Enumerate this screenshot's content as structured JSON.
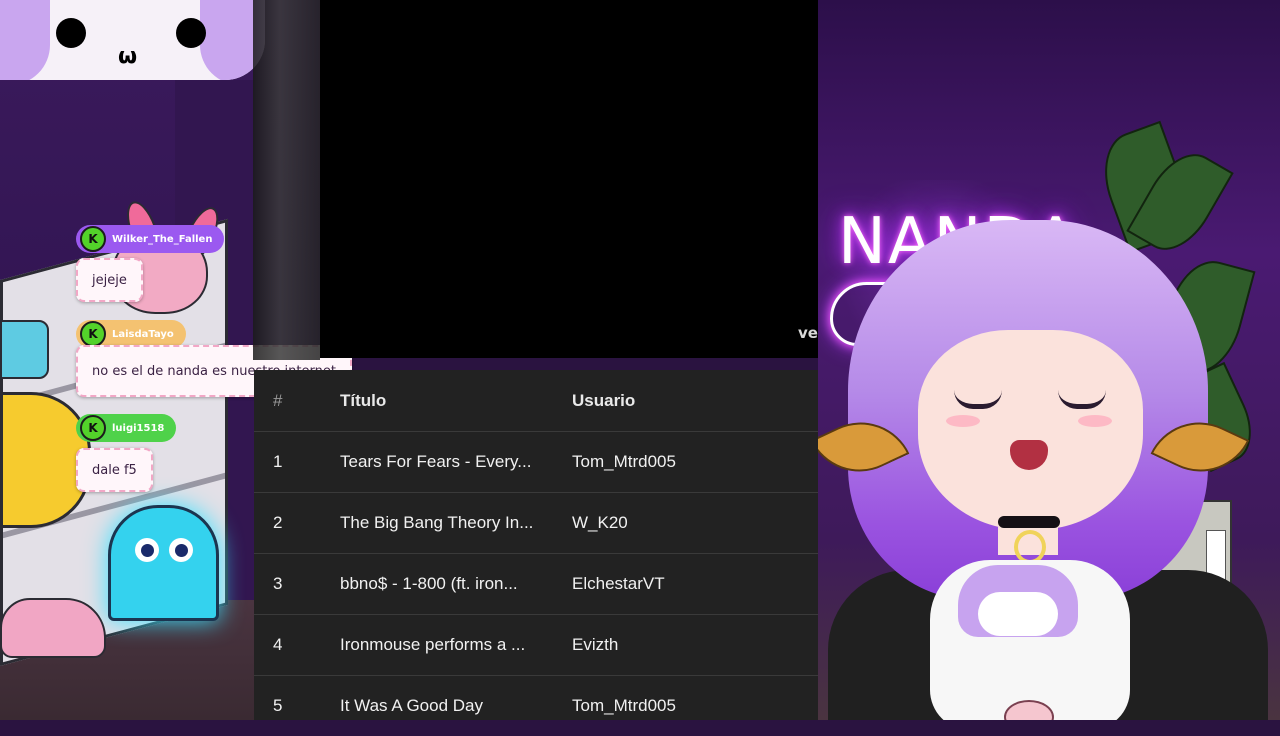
{
  "chat": {
    "messages": [
      {
        "user": "Wilker_The_Fallen",
        "text": "jejeje",
        "badge": "K",
        "user_color": "#9b59f0"
      },
      {
        "user": "LaisdaTayo",
        "text": "no es el de nanda es nuestro internet",
        "badge": "K",
        "user_color": "#f4c271"
      },
      {
        "user": "luigi1518",
        "text": "dale f5",
        "badge": "K",
        "user_color": "#4fd24a"
      }
    ]
  },
  "video": {
    "overflow_text": "ve"
  },
  "queue": {
    "columns": {
      "number": "#",
      "title": "Título",
      "user": "Usuario"
    },
    "rows": [
      {
        "number": "1",
        "title": "Tears For Fears - Every...",
        "user": "Tom_Mtrd005"
      },
      {
        "number": "2",
        "title": "The Big Bang Theory In...",
        "user": "W_K20"
      },
      {
        "number": "3",
        "title": "bbno$ - 1-800 (ft. iron...",
        "user": "ElchestarVT"
      },
      {
        "number": "4",
        "title": "Ironmouse performs a ...",
        "user": "Evizth"
      },
      {
        "number": "5",
        "title": "It Was A Good Day",
        "user": "Tom_Mtrd005"
      }
    ]
  },
  "scene": {
    "neon_sign": "NANDA",
    "icons": {
      "chat_badge": "k-badge-icon",
      "corner_avatar": "avatar-face-icon",
      "ghost": "pacman-ghost-icon",
      "neon_cat": "neon-cat-icon"
    },
    "colors": {
      "accent_purple": "#9b59f0",
      "table_background": "#222222",
      "chat_bubble_border": "#f2a7c6"
    }
  }
}
